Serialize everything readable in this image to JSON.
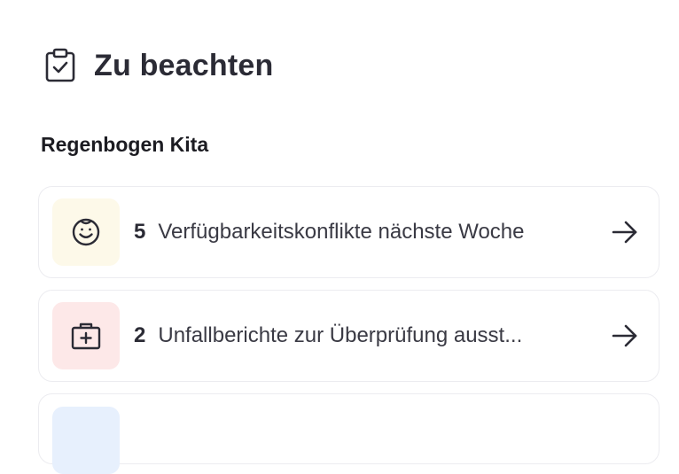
{
  "header": {
    "title": "Zu beachten",
    "icon": "clipboard-check-icon"
  },
  "section": {
    "title": "Regenbogen Kita"
  },
  "items": [
    {
      "count": "5",
      "label": "Verfügbarkeitskonflikte nächste Woche",
      "icon": "smiley-face-icon",
      "icon_bg": "#fdf9e9"
    },
    {
      "count": "2",
      "label": "Unfallberichte zur Überprüfung ausst...",
      "icon": "first-aid-kit-icon",
      "icon_bg": "#fde8e8"
    },
    {
      "icon_bg": "#e7f0fd"
    }
  ],
  "colors": {
    "text_primary": "#2b2b35",
    "card_border": "#ececf0"
  }
}
